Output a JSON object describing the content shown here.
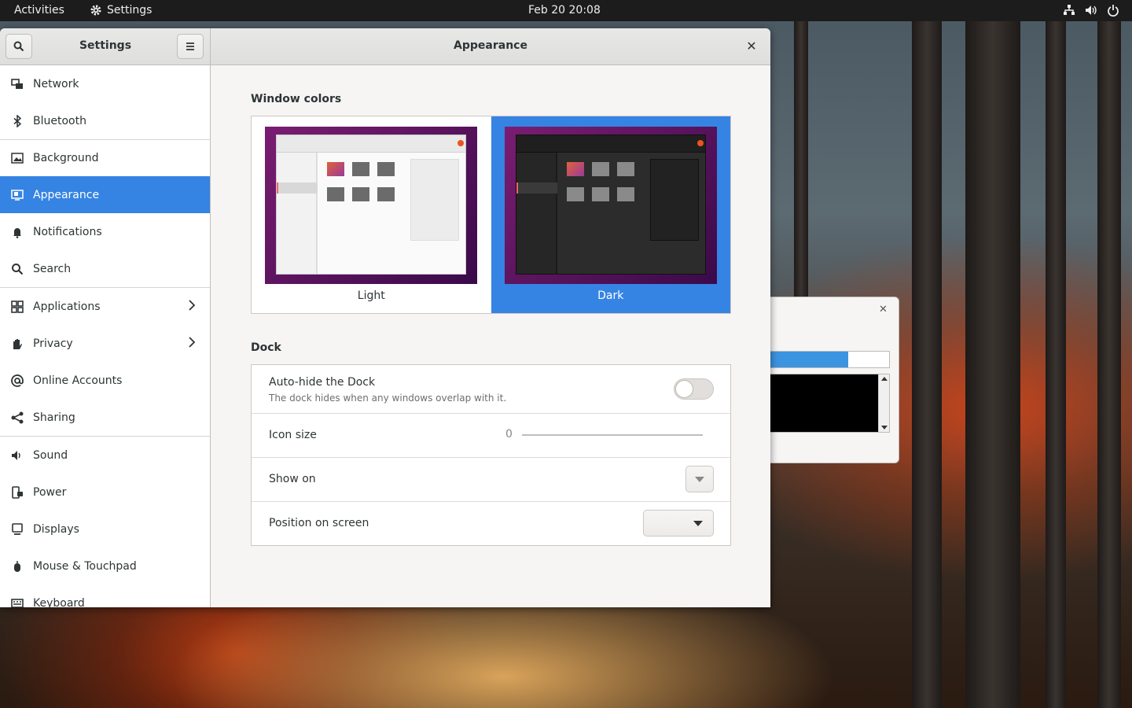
{
  "topbar": {
    "activities": "Activities",
    "app_name": "Settings",
    "clock": "Feb 20  20:08"
  },
  "window": {
    "sidebar_title": "Settings",
    "page_title": "Appearance",
    "close_glyph": "✕"
  },
  "sidebar": {
    "items": [
      {
        "label": "Network",
        "icon": "network-icon"
      },
      {
        "label": "Bluetooth",
        "icon": "bluetooth-icon"
      },
      {
        "label": "Background",
        "icon": "background-icon"
      },
      {
        "label": "Appearance",
        "icon": "appearance-icon",
        "active": true
      },
      {
        "label": "Notifications",
        "icon": "bell-icon"
      },
      {
        "label": "Search",
        "icon": "search-icon"
      },
      {
        "label": "Applications",
        "icon": "applications-icon",
        "chevron": true
      },
      {
        "label": "Privacy",
        "icon": "hand-icon",
        "chevron": true
      },
      {
        "label": "Online Accounts",
        "icon": "at-icon"
      },
      {
        "label": "Sharing",
        "icon": "share-icon"
      },
      {
        "label": "Sound",
        "icon": "speaker-icon"
      },
      {
        "label": "Power",
        "icon": "power-plug-icon"
      },
      {
        "label": "Displays",
        "icon": "display-icon"
      },
      {
        "label": "Mouse & Touchpad",
        "icon": "mouse-icon"
      },
      {
        "label": "Keyboard",
        "icon": "keyboard-icon"
      }
    ]
  },
  "appearance": {
    "window_colors_title": "Window colors",
    "light_label": "Light",
    "dark_label": "Dark",
    "selected": "Dark",
    "dock_title": "Dock",
    "autohide_label": "Auto-hide the Dock",
    "autohide_desc": "The dock hides when any windows overlap with it.",
    "autohide_on": false,
    "icon_size_label": "Icon size",
    "icon_size_value": "0",
    "show_on_label": "Show on",
    "show_on_value": "",
    "position_label": "Position on screen",
    "position_value": ""
  },
  "colors": {
    "accent": "#3584e4",
    "topbar": "#1c1c1c",
    "window_bg": "#f6f5f4"
  }
}
